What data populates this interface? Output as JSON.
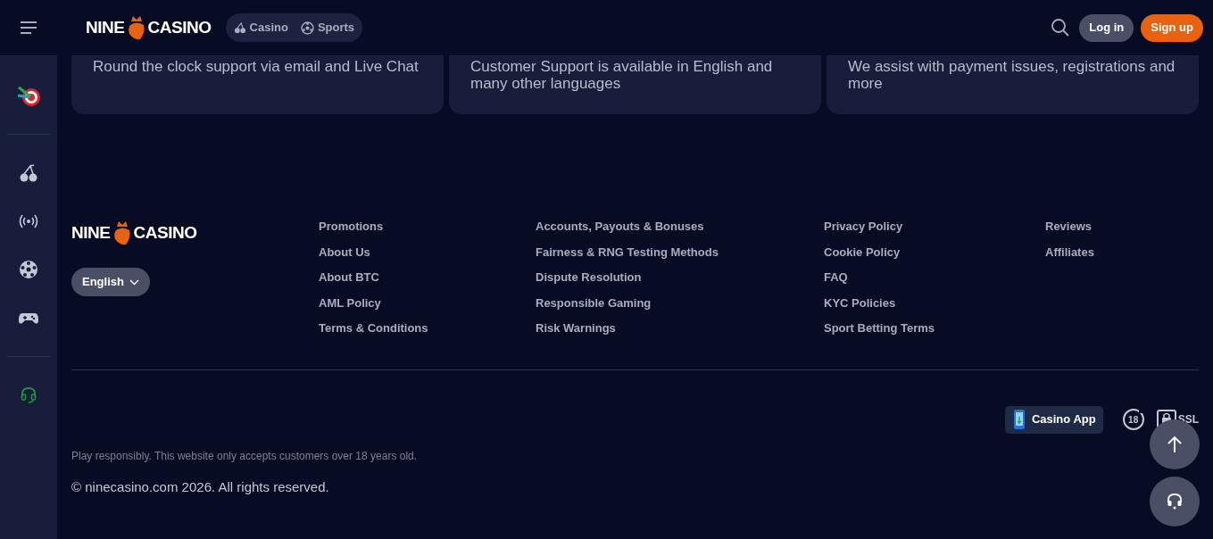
{
  "header": {
    "logo": {
      "left": "NINE",
      "right": "CASINO"
    },
    "nav": [
      {
        "label": "Casino",
        "kind": "casino"
      },
      {
        "label": "Sports",
        "kind": "sports"
      }
    ],
    "login": "Log in",
    "signup": "Sign up"
  },
  "sidebar": {
    "items": [
      {
        "kind": "darts"
      },
      {
        "kind": "divider"
      },
      {
        "kind": "cherry"
      },
      {
        "kind": "live"
      },
      {
        "kind": "soccer"
      },
      {
        "kind": "gamepad"
      },
      {
        "kind": "divider"
      },
      {
        "kind": "support"
      }
    ]
  },
  "cards": [
    "Round the clock support via email and Live Chat",
    "Customer Support is available in English and many other languages",
    "We assist with payment issues, registrations and more"
  ],
  "footer": {
    "logo": {
      "left": "NINE",
      "right": "CASINO"
    },
    "language": "English",
    "link_columns": [
      [
        "Promotions",
        "About Us",
        "About BTC",
        "AML Policy",
        "Terms & Conditions"
      ],
      [
        "Accounts, Payouts & Bonuses",
        "Fairness & RNG Testing Methods",
        "Dispute Resolution",
        "Responsible Gaming",
        "Risk Warnings"
      ],
      [
        "Privacy Policy",
        "Cookie Policy",
        "FAQ",
        "KYC Policies",
        "Sport Betting Terms"
      ],
      [
        "Reviews",
        "Affiliates"
      ]
    ],
    "app_badge": "Casino App",
    "age_badge": "18",
    "ssl": "SSL",
    "disclaimer": "Play responsibly. This website only accepts customers over 18 years old.",
    "copyright": "© ninecasino.com 2026. All rights reserved."
  }
}
